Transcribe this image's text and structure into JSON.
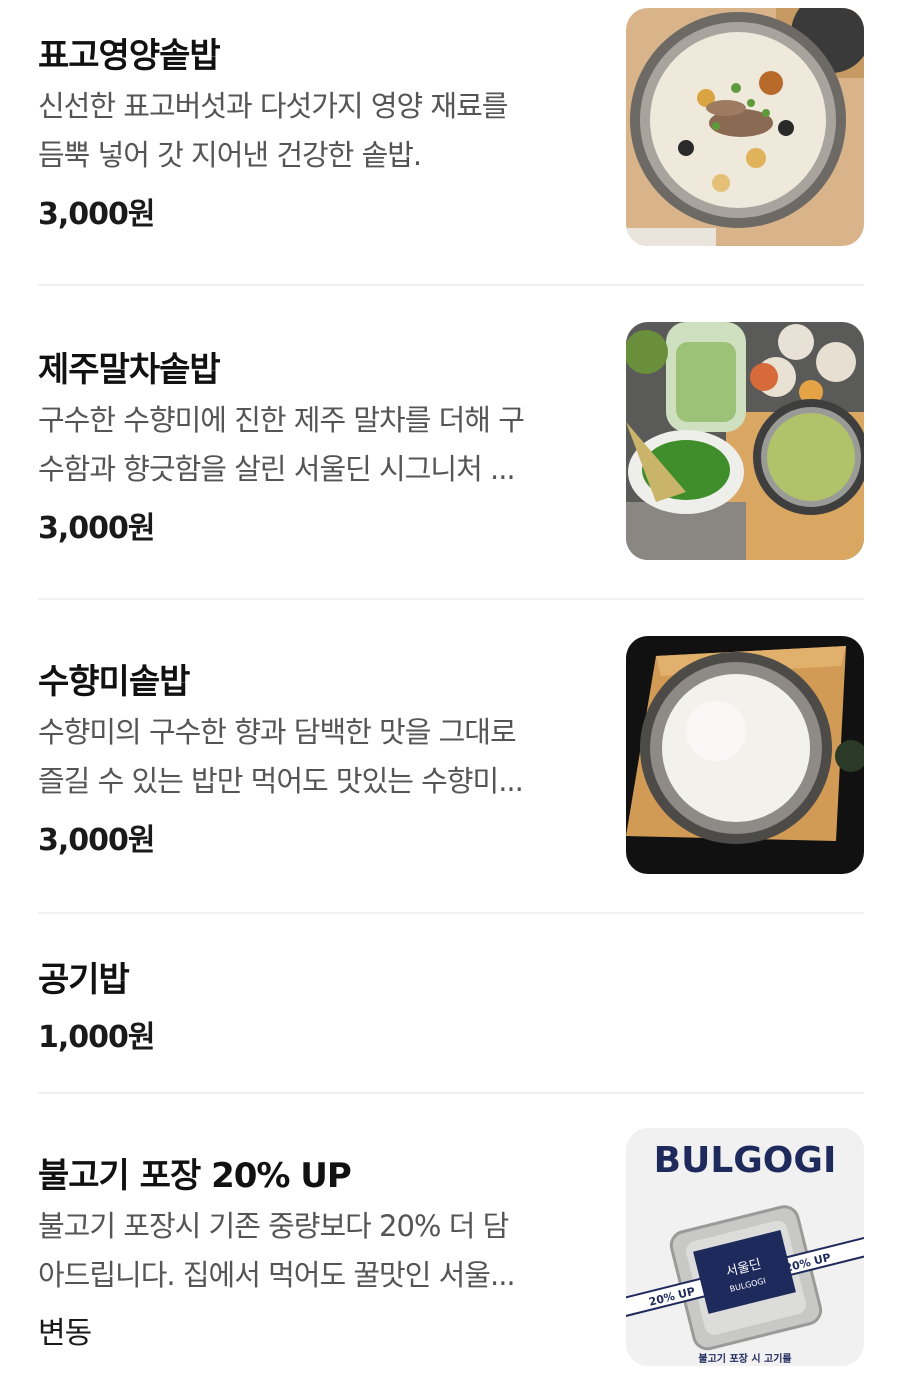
{
  "menu_items": [
    {
      "title": "표고영양솥밥",
      "desc_lines": [
        "신선한 표고버섯과 다섯가지 영양 재료를",
        "듬뿍 넣어 갓 지어낸 건강한 솥밥."
      ],
      "price": "3,000원",
      "image": "mushroom-pot-rice-photo"
    },
    {
      "title": "제주말차솥밥",
      "desc_lines": [
        "구수한 수향미에 진한 제주 말차를 더해 구",
        "수함과 향긋함을 살린 서울딘 시그니처 ..."
      ],
      "price": "3,000원",
      "image": "matcha-pot-rice-photo"
    },
    {
      "title": "수향미솥밥",
      "desc_lines": [
        "수향미의 구수한 향과 담백한 맛을 그대로",
        "즐길 수 있는 밥만 먹어도 맛있는 수향미..."
      ],
      "price": "3,000원",
      "image": "white-pot-rice-photo"
    },
    {
      "title": "공기밥",
      "desc_lines": [],
      "price": "1,000원"
    },
    {
      "title": "불고기 포장 20% UP",
      "desc_lines": [
        "불고기 포장시 기존 중량보다 20% 더 담",
        "아드립니다. 집에서 먹어도 꿀맛인 서울..."
      ],
      "price": "변동",
      "image": "bulgogi-promo-photo"
    }
  ],
  "bulgogi_promo": {
    "headline": "BULGOGI",
    "tape_text": "20% UP",
    "label_main": "서울딘",
    "label_sub": "BULGOGI",
    "footer": "불고기 포장 시 고기를"
  },
  "colors": {
    "title": "#111111",
    "description": "#555555",
    "divider": "#f0f0f0",
    "promo_navy": "#1f2a5c"
  }
}
